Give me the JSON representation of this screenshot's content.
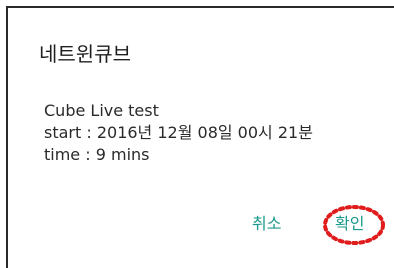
{
  "dialog": {
    "title": "네트윈큐브",
    "message_lines": [
      "Cube Live test",
      "start : 2016년 12월 08일 00시 21분",
      "time : 9 mins"
    ],
    "cancel_label": "취소",
    "ok_label": "확인"
  },
  "colors": {
    "accent": "#1a9a8a",
    "highlight": "#e01c1c",
    "border": "#2a2a2a"
  }
}
